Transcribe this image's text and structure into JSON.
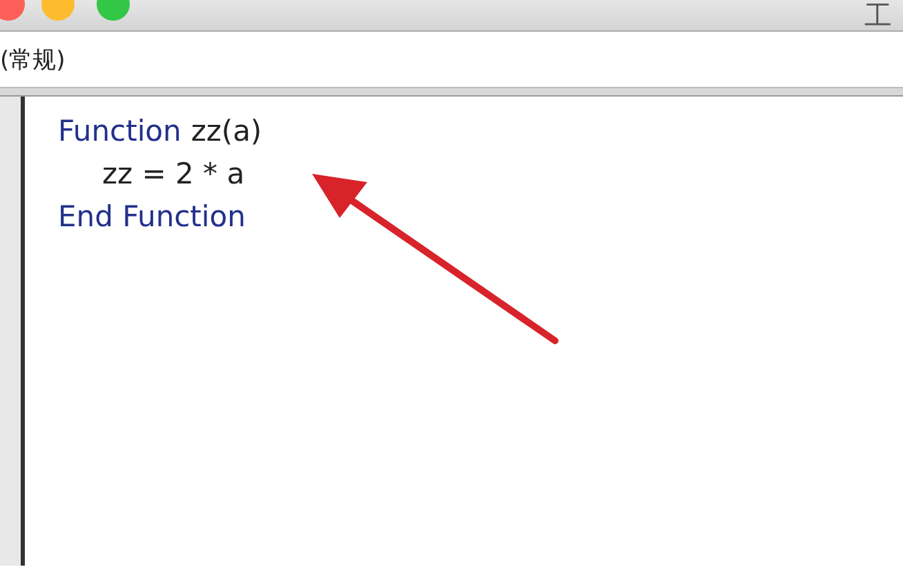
{
  "window": {
    "title": "工"
  },
  "object_dropdown": {
    "value": "(常规)"
  },
  "code_lines": [
    {
      "indent": false,
      "tokens": [
        {
          "kind": "keyword",
          "text": "Function"
        },
        {
          "kind": "plain",
          "text": "zz(a)"
        }
      ]
    },
    {
      "indent": true,
      "tokens": [
        {
          "kind": "plain",
          "text": "zz = 2 * a"
        }
      ]
    },
    {
      "indent": false,
      "tokens": [
        {
          "kind": "keyword",
          "text": "End Function"
        }
      ]
    }
  ]
}
